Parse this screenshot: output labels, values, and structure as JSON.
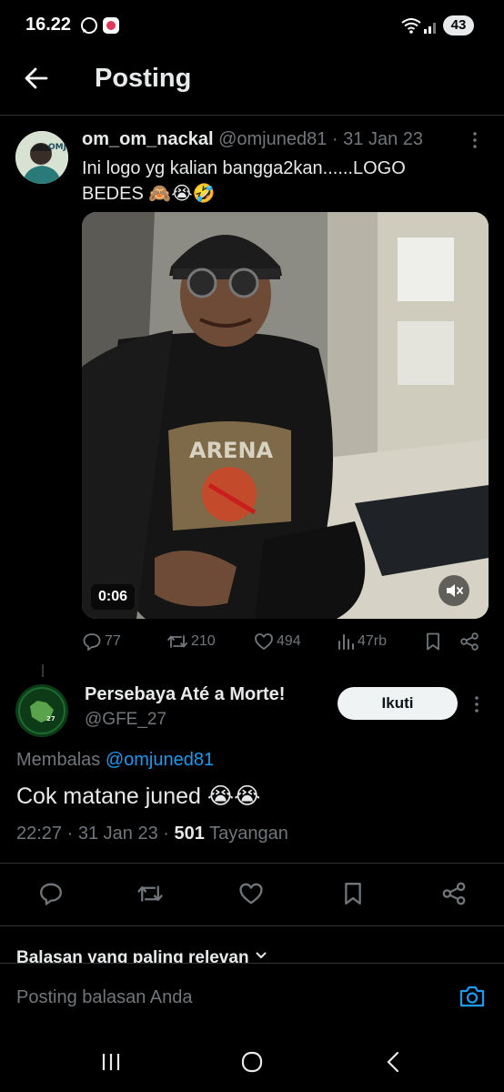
{
  "status_bar": {
    "time": "16.22",
    "battery": "43"
  },
  "header": {
    "title": "Posting"
  },
  "post": {
    "display_name": "om_om_nackal",
    "handle": "@omjuned81",
    "date": "31 Jan 23",
    "text": "Ini logo yg kalian bangga2kan......LOGO BEDES 🙈😭🤣",
    "video_time": "0:06",
    "stats": {
      "replies": "77",
      "reposts": "210",
      "likes": "494",
      "views": "47rb"
    }
  },
  "reply": {
    "display_name": "Persebaya Até a Morte!",
    "handle": "@GFE_27",
    "follow_label": "Ikuti",
    "replying_to_prefix": "Membalas",
    "replying_to": "@omjuned81",
    "text": "Cok matane juned 😭😭",
    "time": "22:27",
    "date": "31 Jan 23",
    "views": "501",
    "views_label": "Tayangan"
  },
  "relevant_label": "Balasan yang paling relevan",
  "composer": {
    "placeholder": "Posting balasan Anda"
  }
}
